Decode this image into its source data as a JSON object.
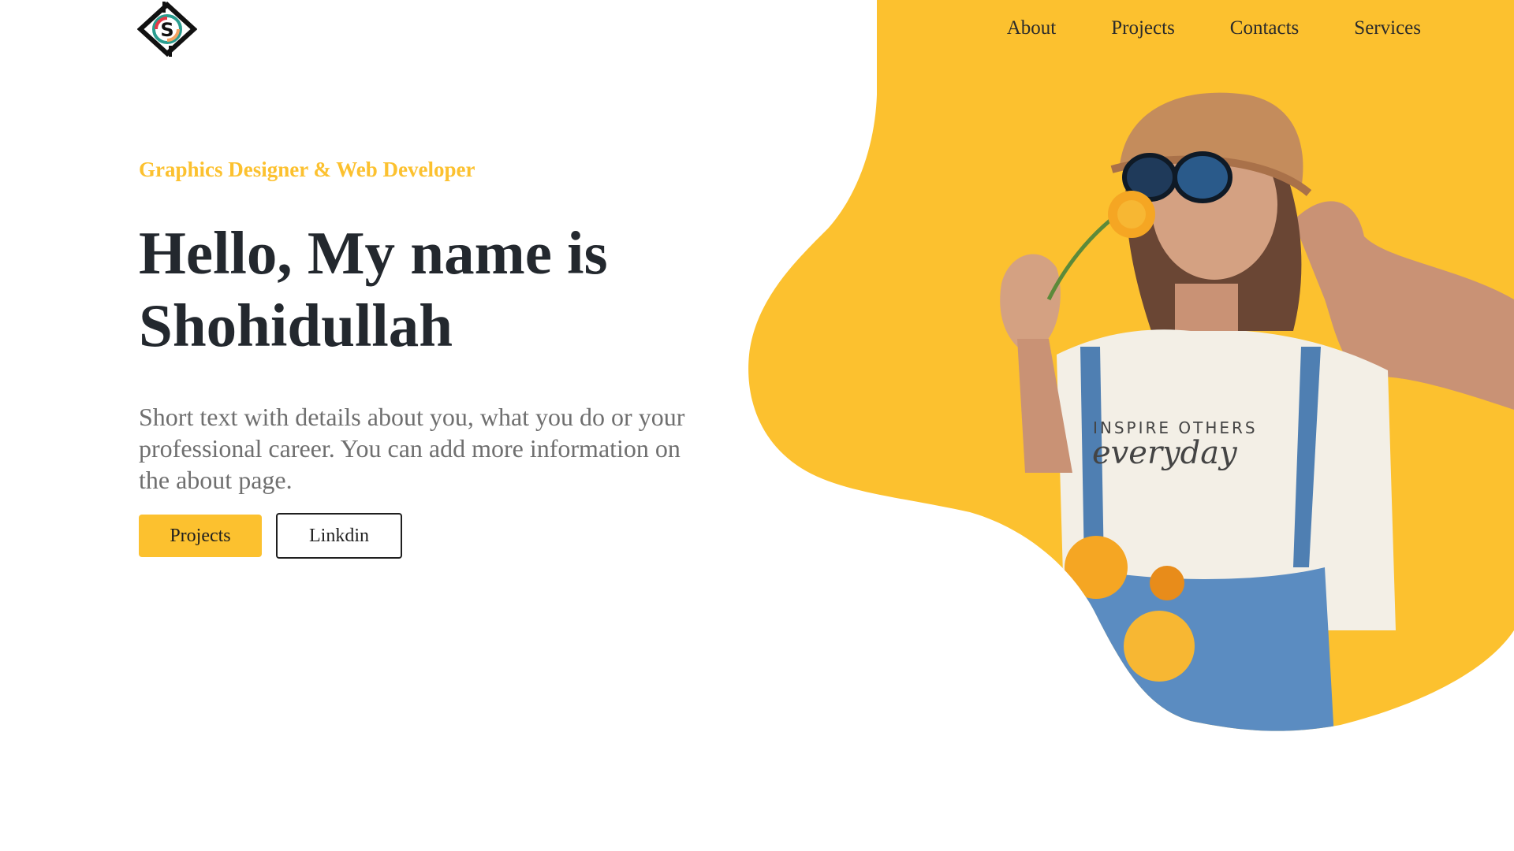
{
  "brand": {
    "logo_icon": "diamond-s-logo-icon",
    "logo_letter": "S"
  },
  "nav": {
    "items": [
      {
        "label": "About"
      },
      {
        "label": "Projects"
      },
      {
        "label": "Contacts"
      },
      {
        "label": "Services"
      }
    ]
  },
  "hero": {
    "eyebrow": "Graphics Designer & Web Developer",
    "headline_line1": "Hello, My name is",
    "headline_line2": "Shohidullah",
    "intro": "Short text with details about you, what you do or your professional career. You can add more information on the about page.",
    "primary_button": "Projects",
    "secondary_button": "Linkdin"
  },
  "photo": {
    "shirt_line1": "INSPIRE OTHERS",
    "shirt_line2": "everyday"
  },
  "colors": {
    "accent": "#fcc12f",
    "text_dark": "#23282e",
    "text_muted": "#6f6f6f",
    "background": "#ffffff"
  }
}
